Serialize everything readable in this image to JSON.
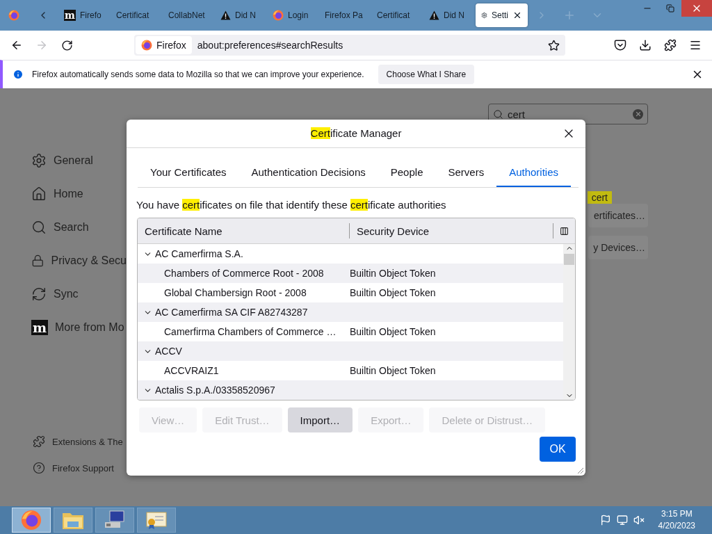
{
  "browser": {
    "tabs": [
      {
        "label": "Firefo",
        "kind": "mozilla",
        "logo": "m",
        "selected": false
      },
      {
        "label": "Certificat",
        "kind": "plain",
        "selected": false
      },
      {
        "label": "CollabNet",
        "kind": "plain",
        "selected": false
      },
      {
        "label": "Did N",
        "kind": "warning",
        "selected": false
      },
      {
        "label": "Login",
        "kind": "firefox",
        "selected": false
      },
      {
        "label": "Firefox Pa",
        "kind": "plain",
        "selected": false
      },
      {
        "label": "Certificat",
        "kind": "plain",
        "selected": false
      },
      {
        "label": "Did N",
        "kind": "warning",
        "selected": false
      },
      {
        "label": "Setti",
        "kind": "settings",
        "selected": true
      }
    ],
    "identity": "Firefox",
    "url": "about:preferences#searchResults"
  },
  "notification": {
    "message": "Firefox automatically sends some data to Mozilla so that we can improve your experience.",
    "button": "Choose What I Share"
  },
  "preferences": {
    "sidebar": [
      {
        "label": "General",
        "kind": "settings"
      },
      {
        "label": "Home",
        "kind": "home"
      },
      {
        "label": "Search",
        "kind": "search"
      },
      {
        "label": "Privacy & Secu",
        "kind": "privacy"
      },
      {
        "label": "Sync",
        "kind": "sync"
      },
      {
        "label": "More from Mo",
        "kind": "mozilla",
        "logo": "m"
      }
    ],
    "footer": [
      {
        "label": "Extensions & The",
        "kind": "extensions"
      },
      {
        "label": "Firefox Support",
        "kind": "support"
      }
    ],
    "search": {
      "value": "cert"
    },
    "results": [
      {
        "kind": "highlight",
        "text": "cert"
      },
      {
        "kind": "button",
        "text": "ertificates…"
      },
      {
        "kind": "button",
        "text": "y Devices…"
      }
    ]
  },
  "dialog": {
    "title": [
      {
        "text": "Cert",
        "highlighted": true
      },
      {
        "text": "ificate Manager",
        "highlighted": false
      }
    ],
    "tabs": [
      {
        "label": "Your Certificates",
        "selected": false
      },
      {
        "label": "Authentication Decisions",
        "selected": false
      },
      {
        "label": "People",
        "selected": false
      },
      {
        "label": "Servers",
        "selected": false
      },
      {
        "label": "Authorities",
        "selected": true
      }
    ],
    "description": [
      {
        "text": "You have ",
        "highlighted": false
      },
      {
        "text": "cert",
        "highlighted": true
      },
      {
        "text": "ificates on file that identify these ",
        "highlighted": false
      },
      {
        "text": "cert",
        "highlighted": true
      },
      {
        "text": "ificate authorities",
        "highlighted": false
      }
    ],
    "columns": [
      "Certificate Name",
      "Security Device"
    ],
    "tree": [
      {
        "name": "AC Camerfirma S.A.",
        "expanded": true,
        "children": [
          {
            "name": "Chambers of Commerce Root - 2008",
            "device": "Builtin Object Token"
          },
          {
            "name": "Global Chambersign Root - 2008",
            "device": "Builtin Object Token"
          }
        ]
      },
      {
        "name": "AC Camerfirma SA CIF A82743287",
        "expanded": true,
        "children": [
          {
            "name": "Camerfirma Chambers of Commerce …",
            "device": "Builtin Object Token"
          }
        ]
      },
      {
        "name": "ACCV",
        "expanded": true,
        "children": [
          {
            "name": "ACCVRAIZ1",
            "device": "Builtin Object Token"
          }
        ]
      },
      {
        "name": "Actalis S.p.A./03358520967",
        "expanded": true
      }
    ],
    "buttons": [
      {
        "label": "View…",
        "disabled": true
      },
      {
        "label": "Edit Trust…",
        "disabled": true
      },
      {
        "label": "Import…",
        "disabled": false
      },
      {
        "label": "Export…",
        "disabled": true
      },
      {
        "label": "Delete or Distrust…",
        "disabled": true
      }
    ],
    "ok": "OK"
  },
  "taskbar": {
    "apps": [
      {
        "kind": "firefox",
        "selected": true
      },
      {
        "kind": "folder",
        "selected": false
      },
      {
        "kind": "computer",
        "selected": false
      },
      {
        "kind": "certificate",
        "selected": false
      }
    ],
    "time": "3:15 PM",
    "date": "4/20/2023"
  }
}
